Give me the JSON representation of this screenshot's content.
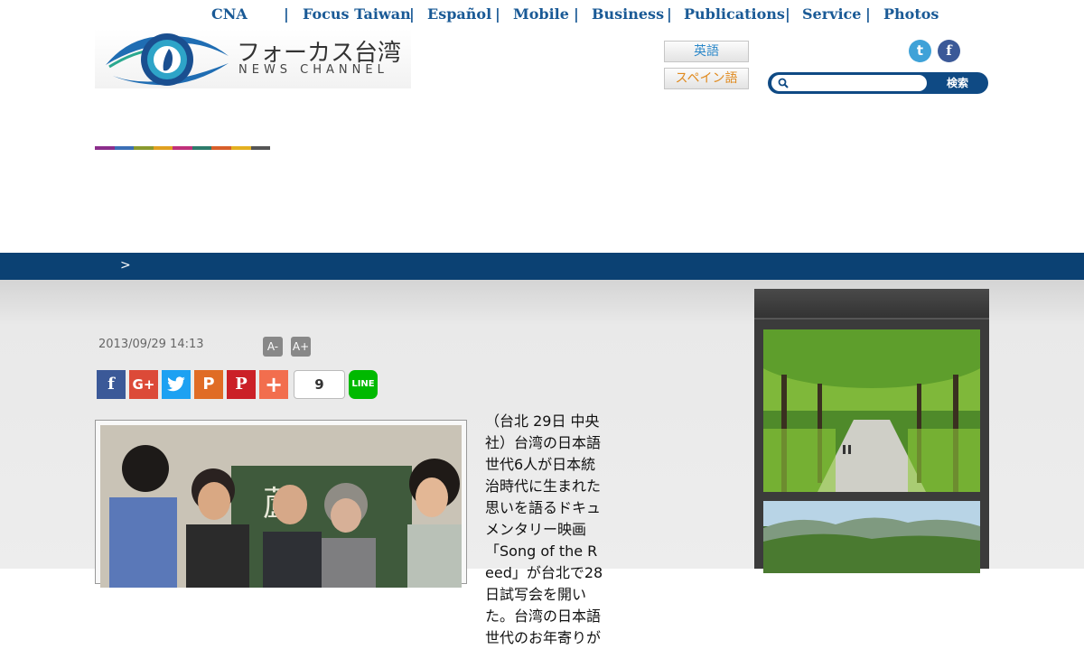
{
  "nav": {
    "items": [
      "CNA",
      "Focus Taiwan",
      "Español",
      "Mobile",
      "Business",
      "Publications",
      "Service",
      "Photos"
    ],
    "separator": "|"
  },
  "logo": {
    "title_jp": "フォーカス台湾",
    "title_en": "NEWS CHANNEL"
  },
  "lang": {
    "english": "英語",
    "spanish": "スペイン語"
  },
  "social": {
    "twitter_icon": "twitter-icon",
    "facebook_icon": "facebook-icon",
    "facebook_glyph": "f",
    "twitter_glyph": "t"
  },
  "search": {
    "placeholder": "",
    "button": "検索"
  },
  "breadcrumb": {
    "arrow": ">"
  },
  "article": {
    "date": "2013/09/29 14:13",
    "font_minus": "A-",
    "font_plus": "A+",
    "share_count": "9",
    "share_icons": {
      "facebook": "f",
      "google_plus": "G+",
      "twitter": "t",
      "plurk": "P",
      "pinterest": "P",
      "add": "+",
      "line": "LINE"
    },
    "body_text": "（台北 29日 中央社）台湾の日本語世代6人が日本統治時代に生まれた思いを語るドキュメンタリー映画「Song of the Reed」が台北で28日試写会を開いた。台湾の日本語世代のお年寄りが"
  },
  "colors": {
    "accent_blue": "#0b4173",
    "link_blue": "#1a5a96",
    "colorbar": [
      "#8b2d8b",
      "#3b6fb6",
      "#8a9a2e",
      "#e0a020",
      "#c0307a",
      "#2d7b6b",
      "#d85f2a",
      "#e4b020",
      "#555555"
    ]
  }
}
